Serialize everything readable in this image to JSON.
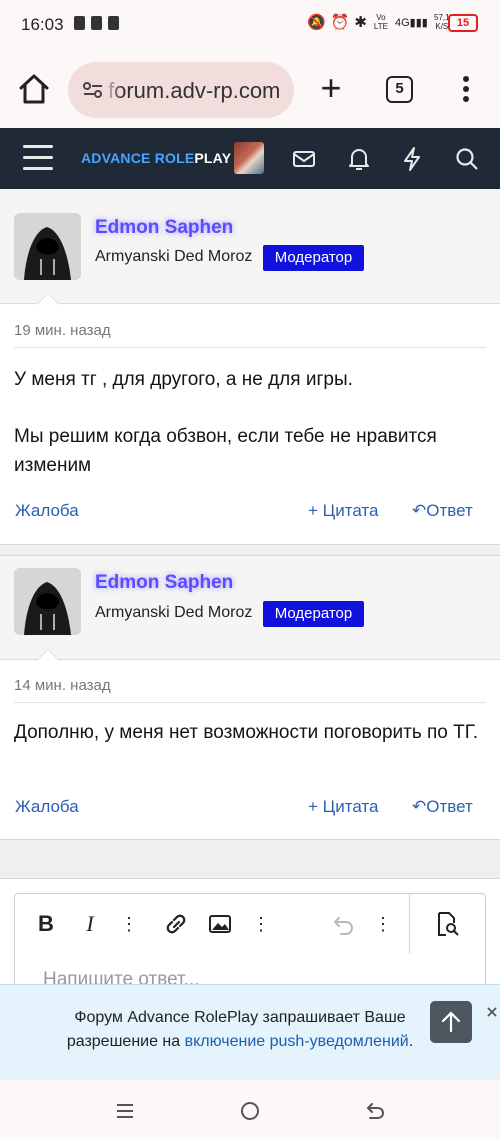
{
  "status_bar": {
    "time": "16:03",
    "network_label": "Vo LTE",
    "signal": "4G",
    "net_speed_value": "57,1",
    "net_speed_unit": "K/S",
    "battery": "15"
  },
  "browser": {
    "url": "forum.adv-rp.com",
    "tab_count": "5"
  },
  "forum_header": {
    "logo_part1": "ADVANCE ",
    "logo_part2": "ROLE",
    "logo_part3": "PLAY"
  },
  "posts": [
    {
      "username": "Edmon Saphen",
      "user_title": "Armyanski Ded Moroz",
      "badge": "Модератор",
      "time": "19 мин. назад",
      "body_lines": [
        "У меня тг , для другого, а не для игры.",
        "Мы решим когда обзвон, если тебе не нравится изменим"
      ],
      "report_label": "Жалоба",
      "quote_label": "Цитата",
      "reply_label": "Ответ"
    },
    {
      "username": "Edmon Saphen",
      "user_title": "Armyanski Ded Moroz",
      "badge": "Модератор",
      "time": "14 мин. назад",
      "body_lines": [
        "Дополню, у меня нет возможности поговорить по ТГ."
      ],
      "report_label": "Жалоба",
      "quote_label": "Цитата",
      "reply_label": "Ответ"
    }
  ],
  "editor": {
    "bold_label": "B",
    "italic_label": "I",
    "placeholder": "Напишите ответ..."
  },
  "push_banner": {
    "text_before": "Форум Advance RolePlay запрашивает Ваше разрешение на ",
    "link_text": "включение push-уведомлений",
    "text_after": "."
  },
  "colors": {
    "header_bg": "#1f2a36",
    "username": "#5b4cff",
    "badge_bg": "#1111dd",
    "link": "#2d5fb0"
  }
}
